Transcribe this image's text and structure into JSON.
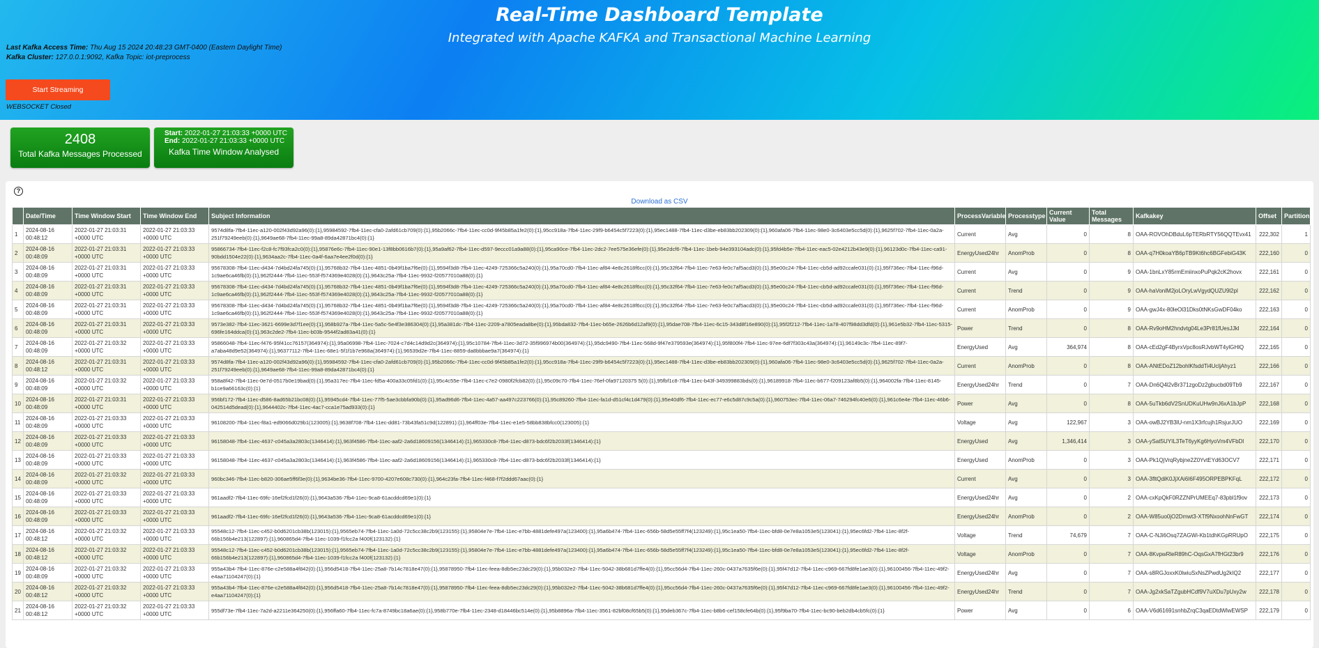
{
  "header": {
    "title": "Real-Time Dashboard Template",
    "subtitle": "Integrated with Apache KAFKA and Transactional Machine Learning",
    "access_label": "Last Kafka Access Time:",
    "access_value": " Thu Aug 15 2024 20:48:23 GMT-0400 (Eastern Daylight Time)",
    "cluster_label": "Kafka Cluster:",
    "cluster_value": " 127.0.0.1:9092, Kafka Topic: iot-preprocess",
    "stream_button": "Start Streaming",
    "ws_status": "WEBSOCKET Closed",
    "colors": {
      "start_button": "#f44a1e",
      "card_green": "#0a7d11",
      "table_header": "#5f7466",
      "row_alt": "#f1f1dc"
    }
  },
  "cards": {
    "total_count": "2408",
    "total_label": "Total Kafka Messages Processed",
    "start_label": "Start:",
    "start_value": " 2022-01-27 21:03:33 +0000 UTC",
    "end_label": "End:",
    "end_value": " 2022-01-27 21:03:33 +0000 UTC",
    "window_label": "Kafka Time Window Analysed"
  },
  "panel": {
    "help_icon": "question-circle-icon",
    "help_glyph": "?",
    "download_link": "Download as CSV"
  },
  "table": {
    "columns": [
      "",
      "Date/Time",
      "Time Window Start",
      "Time Window End",
      "Subject Information",
      "ProcessVariable",
      "Processtype",
      "Current Value",
      "Total Messages",
      "Kafkakey",
      "Offset",
      "Partition"
    ],
    "rows": [
      {
        "n": "1",
        "dt": "2024-08-16 00:48:12",
        "tws": "2022-01-27 21:03:31 +0000 UTC",
        "twe": "2022-01-27 21:03:33 +0000 UTC",
        "subj": "9574d8fa-7fb4-11ec-a120-002f43d92a96(0):{1},95984592-7fb4-11ec-cfa0-2afd61cb709(0):{1},95b2066c-7fb4-11ec-cc0d-9f45b85a1fe2(0):{1},95cc918a-7fb4-11ec-29f9-b6454c5f7223(0):{1},95ec1488-7fb4-11ec-d3be-eb83bb202309(0):{1},960afa06-7fb4-11ec-98e0-3c6403e5cc5d(0):{1},9625f702-7fb4-11ec-0a2a-251f79249eeb(0):{1},9649ae68-7fb4-11ec-99a8-89da42871bc4(0):{1}",
        "pv": "Current",
        "pt": "Avg",
        "cv": "0",
        "tm": "8",
        "key": "OAA-ROVOhDBduL6pTERbRTY56QQTEvx41",
        "off": "222,302",
        "part": "1"
      },
      {
        "n": "2",
        "dt": "2024-08-16 00:48:09",
        "tws": "2022-01-27 21:03:31 +0000 UTC",
        "twe": "2022-01-27 21:03:33 +0000 UTC",
        "subj": "95866734-7fb4-11ec-f2c8-fc7f93fca2c0(0):{1},95876e6c-7fb4-11ec-90e1-13f8bb0616b7(0):{1},95a9af62-7fb4-11ec-d597-9eccc01a9a88(0):{1},95ca90ce-7fb4-11ec-2dc2-7ee575e36efe(0):{1},95e2dcf6-7fb4-11ec-1beb-94e393104adc(0):{1},95fd4b5e-7fb4-11ec-eac5-02e4212b43e9(0):{1},96123d0c-7fb4-11ec-ca91-90bdd1504e22(0):{1},9634aa2c-7fb4-11ec-0a4f-6aa7e4ee2f0d(0):{1}",
        "pv": "EnergyUsed24hr",
        "pt": "AnomProb",
        "cv": "0",
        "tm": "8",
        "key": "OAA-q7H0koaYB6pTB9Kt6hc6BGFebiG43K",
        "off": "222,160",
        "part": "0"
      },
      {
        "n": "3",
        "dt": "2024-08-16 00:48:09",
        "tws": "2022-01-27 21:03:31 +0000 UTC",
        "twe": "2022-01-27 21:03:33 +0000 UTC",
        "subj": "95678308-7fb4-11ec-d434-7d4bd24fa745(0):{1},95768b32-7fb4-11ec-4851-0b49f1ba7f6e(0):{1},9594f3d8-7fb4-11ec-4249-725366c5a240(0):{1},95a70cd0-7fb4-11ec-af84-4e8c2618f6cc(0):{1},95c32f64-7fb4-11ec-7e63-fe0c7af5acd3(0):{1},95e00c24-7fb4-11ec-cb5d-ad92ccafe031(0):{1},95f736ec-7fb4-11ec-f96d-1c9ae6ca46fb(0):{1},962f2444-7fb4-11ec-553f-f574369e4028(0):{1},9643c25a-7fb4-11ec-9932-f20577010a88(0):{1}",
        "pv": "Current",
        "pt": "Avg",
        "cv": "0",
        "tm": "9",
        "key": "OAA-1bnLxY85rmEmiinxoPuPqk2cK2hovx",
        "off": "222,161",
        "part": "0"
      },
      {
        "n": "4",
        "dt": "2024-08-16 00:48:09",
        "tws": "2022-01-27 21:03:31 +0000 UTC",
        "twe": "2022-01-27 21:03:33 +0000 UTC",
        "subj": "95678308-7fb4-11ec-d434-7d4bd24fa745(0):{1},95768b32-7fb4-11ec-4851-0b49f1ba7f6e(0):{1},9594f3d8-7fb4-11ec-4249-725366c5a240(0):{1},95a70cd0-7fb4-11ec-af84-4e8c2618f6cc(0):{1},95c32f64-7fb4-11ec-7e63-fe0c7af5acd3(0):{1},95e00c24-7fb4-11ec-cb5d-ad92ccafe031(0):{1},95f736ec-7fb4-11ec-f96d-1c9ae6ca46fb(0):{1},962f2444-7fb4-11ec-553f-f574369e4028(0):{1},9643c25a-7fb4-11ec-9932-f20577010a88(0):{1}",
        "pv": "Current",
        "pt": "Trend",
        "cv": "0",
        "tm": "9",
        "key": "OAA-haVonlM2joLOryLwVgydQUZU9l2pl",
        "off": "222,162",
        "part": "0"
      },
      {
        "n": "5",
        "dt": "2024-08-16 00:48:09",
        "tws": "2022-01-27 21:03:31 +0000 UTC",
        "twe": "2022-01-27 21:03:33 +0000 UTC",
        "subj": "95678308-7fb4-11ec-d434-7d4bd24fa745(0):{1},95768b32-7fb4-11ec-4851-0b49f1ba7f6e(0):{1},9594f3d8-7fb4-11ec-4249-725366c5a240(0):{1},95a70cd0-7fb4-11ec-af84-4e8c2618f6cc(0):{1},95c32f64-7fb4-11ec-7e63-fe0c7af5acd3(0):{1},95e00c24-7fb4-11ec-cb5d-ad92ccafe031(0):{1},95f736ec-7fb4-11ec-f96d-1c9ae6ca46fb(0):{1},962f2444-7fb4-11ec-553f-f574369e4028(0):{1},9643c25a-7fb4-11ec-9932-f20577010a88(0):{1}",
        "pv": "Current",
        "pt": "AnomProb",
        "cv": "0",
        "tm": "9",
        "key": "OAA-gwJ4x-80leOl31Dks0tNKsGwDF04ko",
        "off": "222,163",
        "part": "0"
      },
      {
        "n": "6",
        "dt": "2024-08-16 00:48:09",
        "tws": "2022-01-27 21:03:31 +0000 UTC",
        "twe": "2022-01-27 21:03:33 +0000 UTC",
        "subj": "9573e382-7fb4-11ec-3621-6699e3d7f1ee(0):{1},958b927a-7fb4-11ec-5a5c-5e4f3e386304(0):{1},95a381dc-7fb4-11ec-2209-a7805eada8be(0):{1},95bda832-7fb4-11ec-b65e-2626b6d12af9(0):{1},95dae708-7fb4-11ec-6c15-343d8f16e890(0):{1},95f2f212-7fb4-11ec-1a78-407f98dd3dfd(0):{1},961e5b32-7fb4-11ec-5315-696fe164ddca(0):{1},963c2de2-7fb4-11ec-b03b-9544f2ad83a41(0):{1}",
        "pv": "Power",
        "pt": "Trend",
        "cv": "0",
        "tm": "8",
        "key": "OAA-Rv9oHM2hndvtg04Le3Pr81fUesJJkl",
        "off": "222,164",
        "part": "0"
      },
      {
        "n": "7",
        "dt": "2024-08-16 00:48:09",
        "tws": "2022-01-27 21:03:32 +0000 UTC",
        "twe": "2022-01-27 21:03:33 +0000 UTC",
        "subj": "95866048-7fb4-11ec-f476-95f41cc76157(364974):{1},95a06998-7fb4-11ec-7024-c7d4c14d9d2c(364974):{1},95c10784-7fb4-11ec-3d72-35f996974b00(364974):{1},95dc9490-7fb4-11ec-568d-9f47e379593e(364974):{1},95f800f4-7fb4-11ec-97ee-6df7f303c43a(364974):{1},96149c3c-7fb4-11ec-89f7-a7aba48d9e52(364974):{1},96377112-7fb4-11ec-68e1-5f1f1b7e968a(364974):{1},96539d2e-7fb4-11ec-8859-da8bbbae9a7(364974):{1}",
        "pv": "EnergyUsed",
        "pt": "Avg",
        "cv": "364,974",
        "tm": "8",
        "key": "OAA-cEd2gF4ByrxVpc8osRJvbWT4ylGHlQ",
        "off": "222,165",
        "part": "0"
      },
      {
        "n": "8",
        "dt": "2024-08-16 00:48:12",
        "tws": "2022-01-27 21:03:31 +0000 UTC",
        "twe": "2022-01-27 21:03:33 +0000 UTC",
        "subj": "9574d8fa-7fb4-11ec-a120-002f43d92a96(0):{1},95984592-7fb4-11ec-cfa0-2afd61cb709(0):{1},95b2066c-7fb4-11ec-cc0d-9f45b85a1fe2(0):{1},95cc918a-7fb4-11ec-29f9-b6454c5f7223(0):{1},95ec1488-7fb4-11ec-d3be-eb83bb202309(0):{1},960afa06-7fb4-11ec-98e0-3c6403e5cc5d(0):{1},9625f702-7fb4-11ec-0a2a-251f79249eeb(0):{1},9649ae68-7fb4-11ec-99a8-89da42871bc4(0):{1}",
        "pv": "Current",
        "pt": "AnomProb",
        "cv": "0",
        "tm": "8",
        "key": "OAA-ANtEDoZ12bohlKfsddTi4UcljAhyz1",
        "off": "222,166",
        "part": "0"
      },
      {
        "n": "9",
        "dt": "2024-08-16 00:48:09",
        "tws": "2022-01-27 21:03:32 +0000 UTC",
        "twe": "2022-01-27 21:03:33 +0000 UTC",
        "subj": "958a8f42-7fb4-11ec-0e7d-0517b0e19bad(0):{1},95a317ec-7fb4-11ec-fd5a-400a33c05fd1(0):{1},95c4c55e-7fb4-11ec-c7e2-0980f2fcb82(0):{1},95c09c70-7fb4-11ec-76ef-0fa97120375 5(0):{1},95fbf1c8-7fb4-11ec-b43f-349399883bds(0):{1},96189918-7fb4-11ec-b677-f209123af8b5(0):{1},964002fa-7fb4-11ec-8145-b1ce9a66163c(0):{1}",
        "pv": "EnergyUsed24hr",
        "pt": "Trend",
        "cv": "0",
        "tm": "7",
        "key": "OAA-Dn6Q4l2vBr371zgoDz2gbucbd09Tb9",
        "off": "222,167",
        "part": "0"
      },
      {
        "n": "10",
        "dt": "2024-08-16 00:48:09",
        "tws": "2022-01-27 21:03:31 +0000 UTC",
        "twe": "2022-01-27 21:03:33 +0000 UTC",
        "subj": "956bf172-7fb4-11ec-d586-8ad65b21bc08(0):{1},95945cd4-7fb4-11ec-77f5-5ae3cbbfa90b(0):{1},95ad96d6-7fb4-11ec-4a57-aa497c223766(0):{1},95c89260-7fb4-11ec-fa1d-d51cf4c1d479(0):{1},95e40df6-7fb4-11ec-ec77-e6c5d87c9c5a(0):{1},960753ec-7fb4-11ec-06a7-746294fc40e6(0):{1},961c6e4e-7fb4-11ec-46b6-042514d5dead(0):{1},9644402c-7fb4-11ec-4ac7-cca1e75ad933(0):{1}",
        "pv": "Power",
        "pt": "Avg",
        "cv": "0",
        "tm": "8",
        "key": "OAA-5uTkb6dV2SnUDKuUHw9nJ6xA1bJpP",
        "off": "222,168",
        "part": "0"
      },
      {
        "n": "11",
        "dt": "2024-08-16 00:48:09",
        "tws": "2022-01-27 21:03:33 +0000 UTC",
        "twe": "2022-01-27 21:03:33 +0000 UTC",
        "subj": "96108200-7fb4-11ec-f8a1-ed9066d029b1(123005):{1},9638f708-7fb4-11ec-dd81-73b43fa51c9d(122891):{1},964ff03e-7fb4-11ec-e1e5-58bb838bfcc0(123005):{1}",
        "pv": "Voltage",
        "pt": "Avg",
        "cv": "122,967",
        "tm": "3",
        "key": "OAA-owBJ2YB3lU-nm1X3rfcujh1RsjurJUO",
        "off": "222,169",
        "part": "0"
      },
      {
        "n": "12",
        "dt": "2024-08-16 00:48:09",
        "tws": "2022-01-27 21:03:33 +0000 UTC",
        "twe": "2022-01-27 21:03:33 +0000 UTC",
        "subj": "96158048-7fb4-11ec-4637-c045a3a2803c(1346414):{1},963f4586-7fb4-11ec-aaf2-2a6d18609156(1346414):{1},965330c8-7fb4-11ec-d873-bdc6f2b2033f(1346414):{1}",
        "pv": "EnergyUsed",
        "pt": "Avg",
        "cv": "1,346,414",
        "tm": "3",
        "key": "OAA-ySat5UYIL3TeT6yyKg6HyoVm4VFbDl",
        "off": "222,170",
        "part": "0"
      },
      {
        "n": "13",
        "dt": "2024-08-16 00:48:09",
        "tws": "2022-01-27 21:03:33 +0000 UTC",
        "twe": "2022-01-27 21:03:33 +0000 UTC",
        "subj": "96158048-7fb4-11ec-4637-c045a3a2803c(1346414):{1},963f4586-7fb4-11ec-aaf2-2a6d18609156(1346414):{1},965330c8-7fb4-11ec-d873-bdc6f2b2033f(1346414):{1}",
        "pv": "EnergyUsed",
        "pt": "AnomProb",
        "cv": "0",
        "tm": "3",
        "key": "OAA-Pk1QjVrqRybjne2Z0YvtEYd63OCV7",
        "off": "222,171",
        "part": "0"
      },
      {
        "n": "14",
        "dt": "2024-08-16 00:48:09",
        "tws": "2022-01-27 21:03:32 +0000 UTC",
        "twe": "2022-01-27 21:03:33 +0000 UTC",
        "subj": "960bc346-7fb4-11ec-b820-306ae5ff6f3e(0):{1},9634be36-7fb4-11ec-9700-4207e608c730(0):{1},964c23fa-7fb4-11ec-f468-f7f2ddd67aac(0):{1}",
        "pv": "Current",
        "pt": "Avg",
        "cv": "0",
        "tm": "3",
        "key": "OAA-3fltQdiK0JjXAi6I6F495ORPEBPKFqL",
        "off": "222,172",
        "part": "0"
      },
      {
        "n": "15",
        "dt": "2024-08-16 00:48:09",
        "tws": "2022-01-27 21:03:33 +0000 UTC",
        "twe": "2022-01-27 21:03:33 +0000 UTC",
        "subj": "961aadf2-7fb4-11ec-69fc-16ef2fcd1f26(0):{1},9643a536-7fb4-11ec-9ca8-61acddcd69e1(0):{1}",
        "pv": "EnergyUsed24hr",
        "pt": "Avg",
        "cv": "0",
        "tm": "2",
        "key": "OAA-cxKpQkF0RZZNPrUMEEq7-83pbl1f9ov",
        "off": "222,173",
        "part": "0"
      },
      {
        "n": "16",
        "dt": "2024-08-16 00:48:09",
        "tws": "2022-01-27 21:03:33 +0000 UTC",
        "twe": "2022-01-27 21:03:33 +0000 UTC",
        "subj": "961aadf2-7fb4-11ec-69fc-16ef2fcd1f26(0):{1},9643a536-7fb4-11ec-9ca8-61acddcd69e1(0):{1}",
        "pv": "EnergyUsed24hr",
        "pt": "AnomProb",
        "cv": "0",
        "tm": "2",
        "key": "OAA-W85uo0jO2Dmwt3-XTf9NxoohNnFwGT",
        "off": "222,174",
        "part": "0"
      },
      {
        "n": "17",
        "dt": "2024-08-16 00:48:12",
        "tws": "2022-01-27 21:03:32 +0000 UTC",
        "twe": "2022-01-27 21:03:33 +0000 UTC",
        "subj": "95548c12-7fb4-11ec-c452-b0d6201cb38b(123015):{1},9565eb74-7fb4-11ec-1a0d-72c5cc38c2b9(123155):{1},95804e7e-7fb4-11ec-e7bb-4881defe497a(123400):{1},95a6b474-7fb4-11ec-656b-58d5e55ff7f4(123249):{1},95c1ea50-7fb4-11ec-bfd8-0e7e8a1053e5(123041):{1},95ec6fd2-7fb4-11ec-8f2f-66b156b4e213(122897):{1},960865d4-7fb4-11ec-1039-f1fcc2a f400f(123132):{1}",
        "pv": "Voltage",
        "pt": "Trend",
        "cv": "74,679",
        "tm": "7",
        "key": "OAA-C-NJi6Osq7ZAGWi-Kb1tdhKGpRRUpO",
        "off": "222,175",
        "part": "0"
      },
      {
        "n": "18",
        "dt": "2024-08-16 00:48:12",
        "tws": "2022-01-27 21:03:32 +0000 UTC",
        "twe": "2022-01-27 21:03:33 +0000 UTC",
        "subj": "95548c12-7fb4-11ec-c452-b0d6201cb38b(123015):{1},9565eb74-7fb4-11ec-1a0d-72c5cc38c2b9(123155):{1},95804e7e-7fb4-11ec-e7bb-4881defe497a(123400):{1},95a6b474-7fb4-11ec-656b-58d5e55ff7f4(123249):{1},95c1ea50-7fb4-11ec-bfd8-0e7e8a1053e5(123041):{1},95ec6fd2-7fb4-11ec-8f2f-66b156b4e213(122897):{1},960865d4-7fb4-11ec-1039-f1fcc2a f400f(123132):{1}",
        "pv": "Voltage",
        "pt": "AnomProb",
        "cv": "0",
        "tm": "7",
        "key": "OAA-8KvpwRleR89hC-OqsGxA7fHGt23br9",
        "off": "222,176",
        "part": "0"
      },
      {
        "n": "19",
        "dt": "2024-08-16 00:48:09",
        "tws": "2022-01-27 21:03:32 +0000 UTC",
        "twe": "2022-01-27 21:03:33 +0000 UTC",
        "subj": "955a43b4-7fb4-11ec-876e-c2e588a4f842(0):{1},956d5418-7fb4-11ec-25a8-7b14c7818e47(0):{1},95878950-7fb4-11ec-feea-8db5ec23dc29(0):{1},95b032e2-7fb4-11ec-5042-38b681d7ffe4(0):{1},95cc56d4-7fb4-11ec-260c-0437a7635f6e(0):{1},95f47d12-7fb4-11ec-c969-667fd8fe1ae3(0):{1},96100456-7fb4-11ec-49f2-e4aa71104247(0):{1}",
        "pv": "EnergyUsed24hr",
        "pt": "Avg",
        "cv": "0",
        "tm": "7",
        "key": "OAA-s8RGJoxxK0lwiuSxNsZPwdUg2kIQ2",
        "off": "222,177",
        "part": "0"
      },
      {
        "n": "20",
        "dt": "2024-08-16 00:48:12",
        "tws": "2022-01-27 21:03:32 +0000 UTC",
        "twe": "2022-01-27 21:03:33 +0000 UTC",
        "subj": "955a43b4-7fb4-11ec-876e-c2e588a4f842(0):{1},956d5418-7fb4-11ec-25a8-7b14c7818e47(0):{1},95878950-7fb4-11ec-feea-8db5ec23dc29(0):{1},95b032e2-7fb4-11ec-5042-38b681d7ffe4(0):{1},95cc56d4-7fb4-11ec-260c-0437a7635f6e(0):{1},95f47d12-7fb4-11ec-c969-667fd8fe1ae3(0):{1},96100456-7fb4-11ec-49f2-e4aa71104247(0):{1}",
        "pv": "EnergyUsed24hr",
        "pt": "Trend",
        "cv": "0",
        "tm": "7",
        "key": "OAA-Jg2xkSaTZgubHCdf9V7uXDu7pUxy2w",
        "off": "222,178",
        "part": "0"
      },
      {
        "n": "21",
        "dt": "2024-08-16 00:48:12",
        "tws": "2022-01-27 21:03:32 +0000 UTC",
        "twe": "2022-01-27 21:03:33 +0000 UTC",
        "subj": "955df73e-7fb4-11ec-7a2d-a2211e364250(0):{1},956ffa60-7fb4-11ec-fc7a-8749bc18a6ae(0):{1},958b770e-7fb4-11ec-2348-d18446bc514e(0):{1},95b8896a-7fb4-11ec-3561-82bf08cf65b5(0):{1},95deb367c-7fb4-11ec-b8b6-cef158cfe64b(0):{1},95f9ba70-7fb4-11ec-bc90-beb2db4cb5fc(0):{1}",
        "pv": "Power",
        "pt": "Avg",
        "cv": "0",
        "tm": "6",
        "key": "OAA-V6d61691snhbZrqC3qaEDtdWlwEWSP",
        "off": "222,179",
        "part": "0"
      }
    ]
  }
}
